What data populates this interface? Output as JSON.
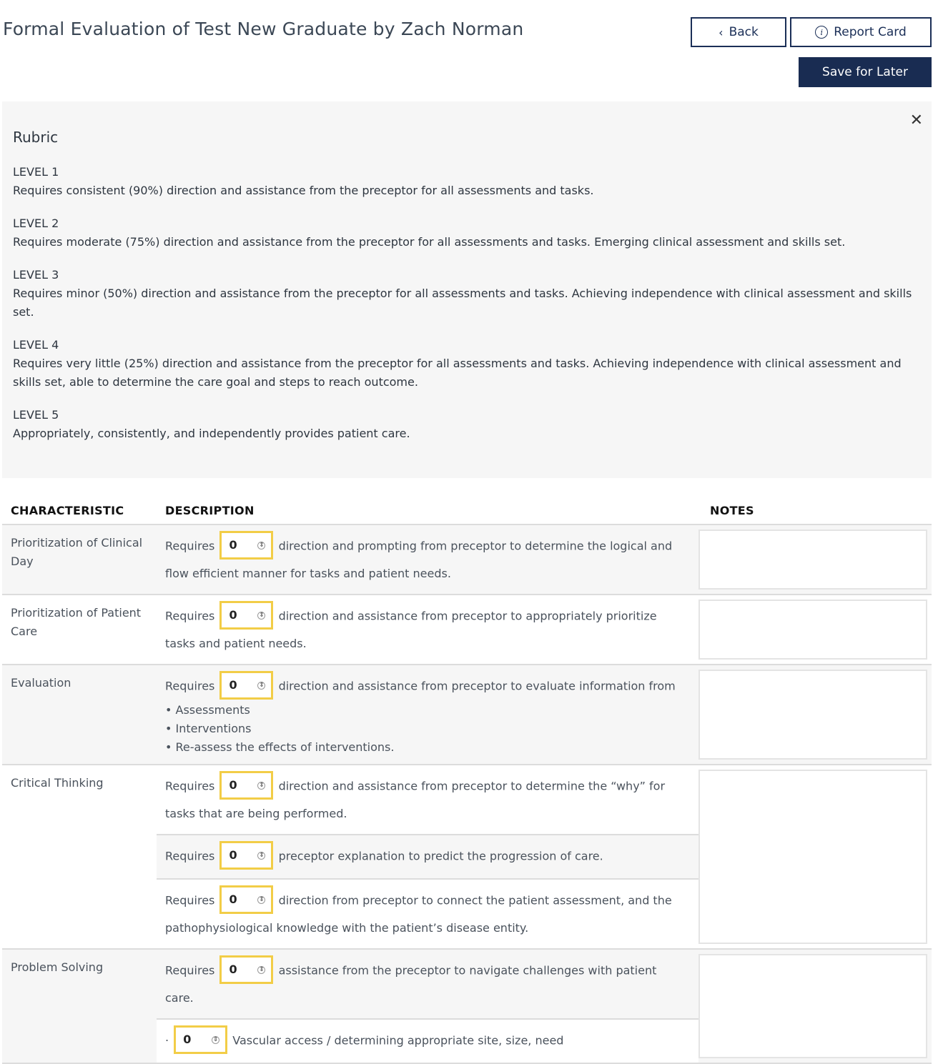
{
  "header": {
    "title": "Formal Evaluation of Test New Graduate by Zach Norman",
    "back_label": "Back",
    "report_card_label": "Report Card",
    "save_label": "Save for Later"
  },
  "rubric": {
    "title": "Rubric",
    "levels": [
      {
        "name": "LEVEL 1",
        "desc": "Requires consistent (90%) direction and assistance from the preceptor for all assessments and tasks."
      },
      {
        "name": "LEVEL 2",
        "desc": "Requires moderate (75%) direction and assistance from the preceptor for all assessments and tasks. Emerging clinical assessment and skills set."
      },
      {
        "name": "LEVEL 3",
        "desc": "Requires minor (50%) direction and assistance from the preceptor for all assessments and tasks. Achieving independence with clinical assessment and skills set."
      },
      {
        "name": "LEVEL 4",
        "desc": "Requires very little (25%) direction and assistance from the preceptor for all assessments and tasks. Achieving independence with clinical assessment and skills set, able to determine the care goal and steps to reach outcome."
      },
      {
        "name": "LEVEL 5",
        "desc": "Appropriately, consistently, and independently provides patient care."
      }
    ]
  },
  "table": {
    "headers": {
      "characteristic": "CHARACTERISTIC",
      "description": "DESCRIPTION",
      "notes": "NOTES"
    },
    "requires": "Requires",
    "rows": [
      {
        "characteristic": "Prioritization of Clinical Day",
        "items": [
          {
            "value": "0",
            "text": "direction and prompting from preceptor to determine the logical and flow efficient manner for tasks and patient needs."
          }
        ]
      },
      {
        "characteristic": "Prioritization of Patient Care",
        "items": [
          {
            "value": "0",
            "text": "direction and assistance from preceptor to appropriately prioritize tasks and patient needs."
          }
        ]
      },
      {
        "characteristic": "Evaluation",
        "items": [
          {
            "value": "0",
            "text": "direction and assistance from preceptor to evaluate information from",
            "bullets": [
              "• Assessments",
              "• Interventions",
              "• Re-assess the effects of interventions."
            ]
          }
        ]
      },
      {
        "characteristic": "Critical Thinking",
        "items": [
          {
            "value": "0",
            "text": "direction and assistance from preceptor to determine the “why” for tasks that are being performed."
          },
          {
            "value": "0",
            "text": "preceptor explanation to predict the progression of care."
          },
          {
            "value": "0",
            "text": "direction from preceptor to connect the patient assessment, and the pathophysiological knowledge with the patient’s disease entity."
          }
        ]
      },
      {
        "characteristic": "Problem Solving",
        "items": [
          {
            "value": "0",
            "text": "assistance from the preceptor to navigate challenges with patient care."
          },
          {
            "value": "0",
            "prefix": "·",
            "text": "Vascular access / determining appropriate site, size, need"
          }
        ]
      }
    ]
  }
}
